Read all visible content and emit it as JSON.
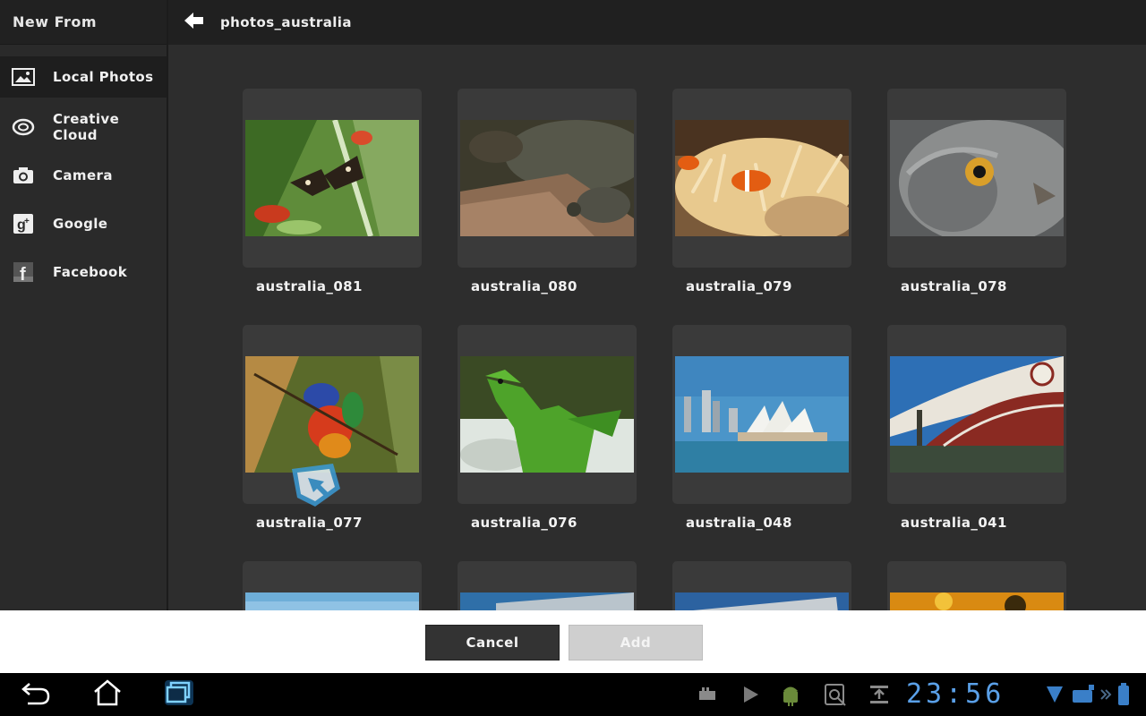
{
  "sidebar": {
    "title": "New From",
    "items": [
      {
        "label": "Local Photos",
        "icon": "image-icon"
      },
      {
        "label": "Creative Cloud",
        "icon": "creative-cloud-icon"
      },
      {
        "label": "Camera",
        "icon": "camera-icon"
      },
      {
        "label": "Google",
        "icon": "google-icon"
      },
      {
        "label": "Facebook",
        "icon": "facebook-icon"
      }
    ]
  },
  "header": {
    "title": "photos_australia"
  },
  "photos": [
    {
      "label": "australia_081"
    },
    {
      "label": "australia_080"
    },
    {
      "label": "australia_079"
    },
    {
      "label": "australia_078"
    },
    {
      "label": "australia_077"
    },
    {
      "label": "australia_076"
    },
    {
      "label": "australia_048"
    },
    {
      "label": "australia_041"
    }
  ],
  "footer": {
    "cancel_label": "Cancel",
    "add_label": "Add"
  },
  "system_bar": {
    "clock": "23:56"
  },
  "colors": {
    "accent_clock": "#5aa0e8",
    "background": "#2d2d2d",
    "card": "#3a3a3a"
  }
}
